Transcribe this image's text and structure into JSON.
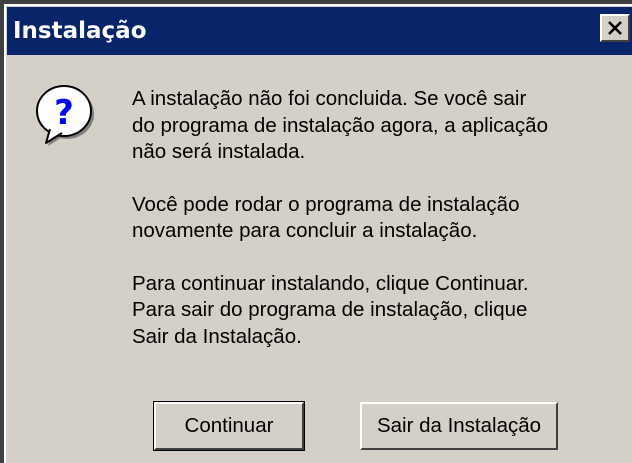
{
  "window": {
    "title": "Instalação",
    "close_glyph": "close-icon"
  },
  "icon": {
    "name": "question-icon",
    "glyph": "?",
    "color": "#0000ff"
  },
  "message": {
    "paragraph1_line1": "A instalação não foi concluida.  Se você sair",
    "paragraph1_line2": "do programa de instalação agora, a aplicação",
    "paragraph1_line3": "não será instalada.",
    "paragraph2_line1": "Você pode rodar o programa de instalação",
    "paragraph2_line2": "novamente para concluir a instalação.",
    "paragraph3_line1": "Para continuar instalando, clique Continuar.",
    "paragraph3_line2": "Para sair do programa de instalação, clique",
    "paragraph3_line3": "Sair da Instalação."
  },
  "buttons": {
    "continue_label": "Continuar",
    "exit_label": "Sair da Instalação"
  },
  "colors": {
    "titlebar": "#0a246a",
    "face": "#d4d0c8"
  }
}
